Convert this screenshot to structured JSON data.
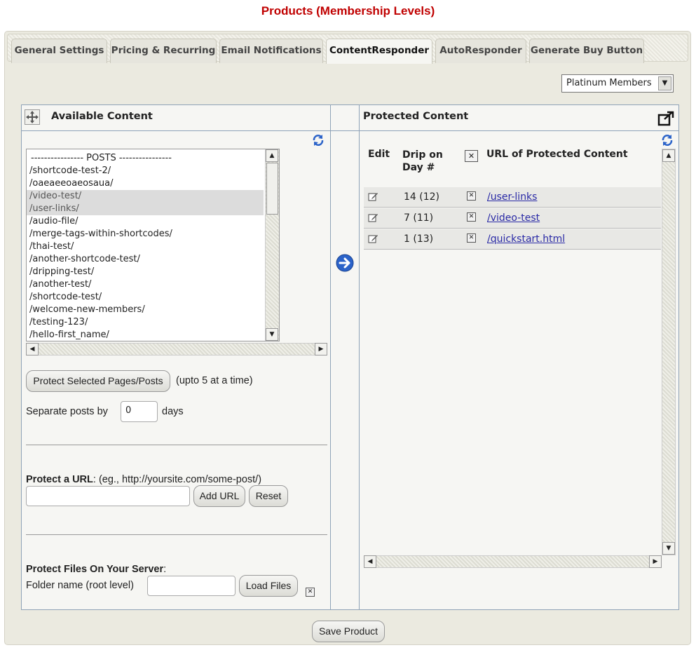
{
  "page_title": "Products (Membership Levels)",
  "tabs": [
    {
      "label": "General Settings"
    },
    {
      "label": "Pricing & Recurring"
    },
    {
      "label": "Email Notifications"
    },
    {
      "label": "ContentResponder",
      "active": true
    },
    {
      "label": "AutoResponder"
    },
    {
      "label": "Generate Buy Button"
    }
  ],
  "level_select": {
    "value": "Platinum Members"
  },
  "available": {
    "title": "Available Content",
    "items": [
      "---------------- POSTS ----------------",
      "/shortcode-test-2/",
      "/oaeaeeoaeosaua/",
      "/video-test/",
      "/user-links/",
      "/audio-file/",
      "/merge-tags-within-shortcodes/",
      "/thai-test/",
      "/another-shortcode-test/",
      "/dripping-test/",
      "/another-test/",
      "/shortcode-test/",
      "/welcome-new-members/",
      "/testing-123/",
      "/hello-first_name/"
    ],
    "selected_items": [
      "/video-test/",
      "/user-links/"
    ],
    "protect_button": "Protect Selected Pages/Posts",
    "protect_note": "(upto 5 at a time)",
    "separate_label": "Separate posts by",
    "separate_value": "0",
    "separate_unit": "days",
    "protect_url_label": "Protect a URL",
    "protect_url_hint": ": (eg., http://yoursite.com/some-post/)",
    "add_url_button": "Add URL",
    "reset_button": "Reset",
    "protect_files_label": "Protect Files On Your Server",
    "protect_files_colon": ":",
    "folder_label": "Folder name (root level)",
    "load_files_button": "Load Files"
  },
  "protected": {
    "title": "Protected Content",
    "col_edit": "Edit",
    "col_drip": "Drip on Day #",
    "col_url": "URL of Protected Content",
    "rows": [
      {
        "drip": "14 (12)",
        "url": "/user-links"
      },
      {
        "drip": "7 (11)",
        "url": "/video-test"
      },
      {
        "drip": "1 (13)",
        "url": "/quickstart.html"
      }
    ]
  },
  "save_button": "Save Product",
  "colors": {
    "title": "#c00000",
    "link": "#2a2aa6",
    "panel_border": "#8fa3b8",
    "arrow_blue": "#2b63c9"
  }
}
